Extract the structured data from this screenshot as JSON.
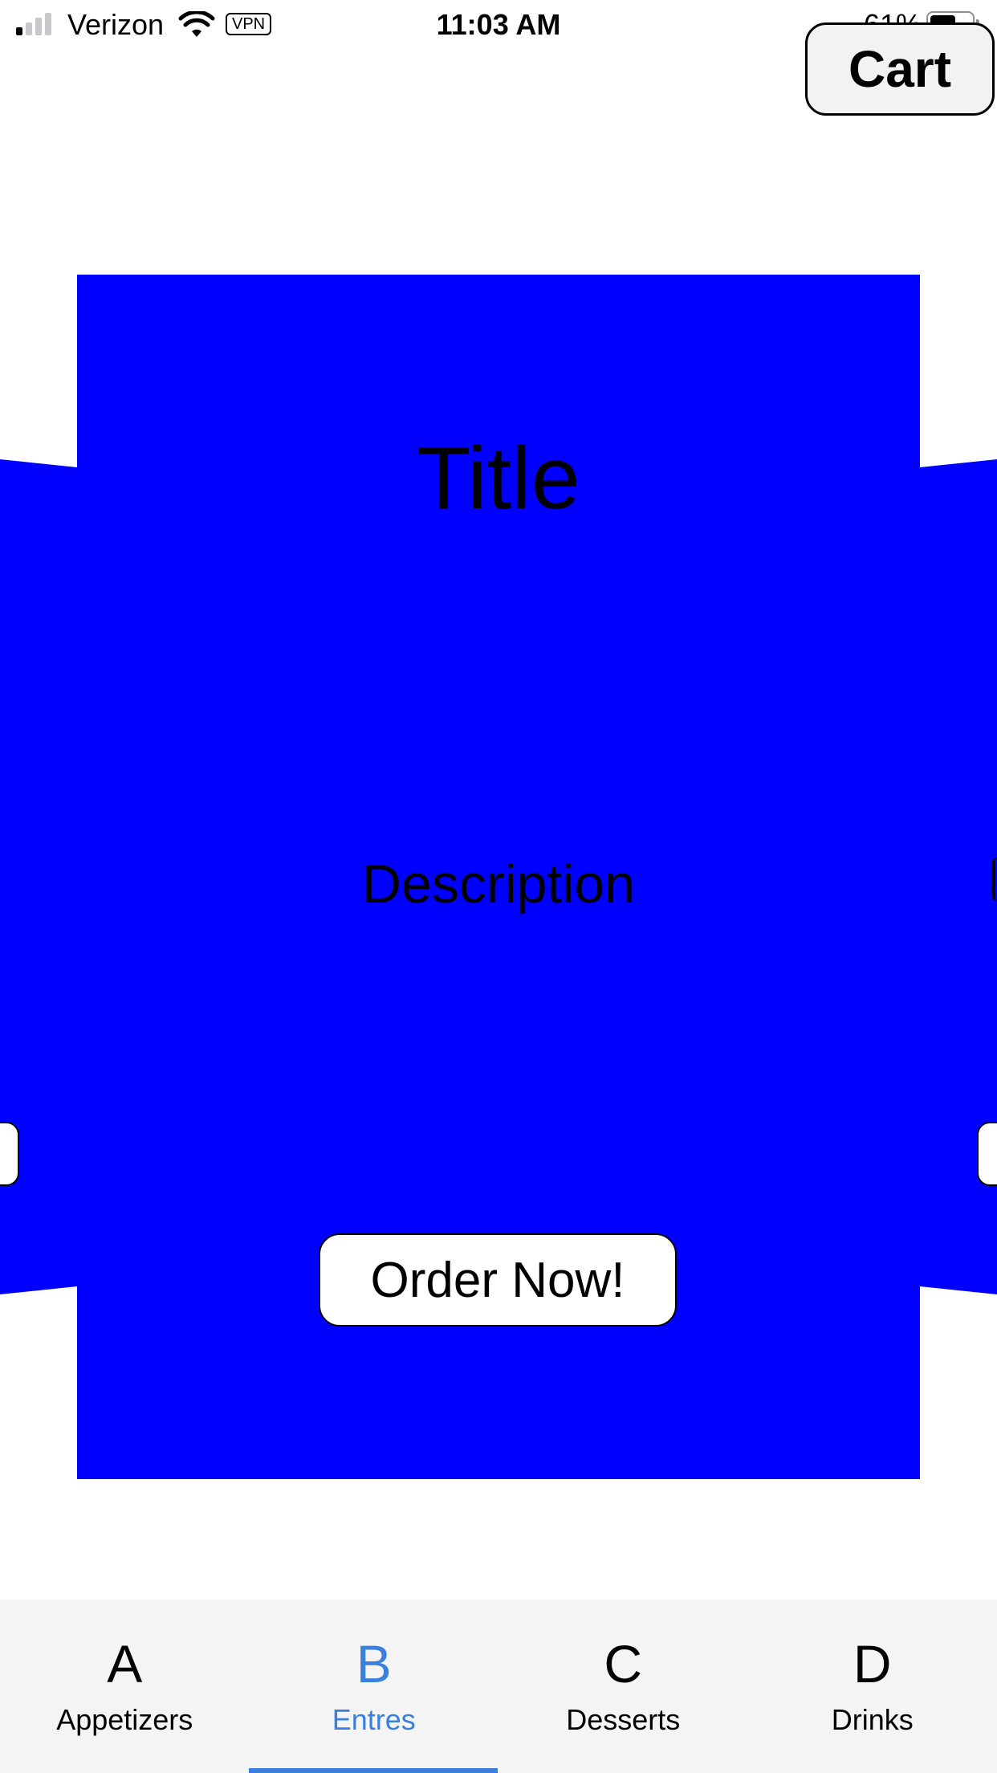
{
  "status_bar": {
    "carrier": "Verizon",
    "vpn_label": "VPN",
    "time": "11:03 AM",
    "battery_percent": "61%",
    "battery_level": 0.61,
    "signal_bars_active": 1,
    "signal_bars_total": 4
  },
  "header": {
    "cart_label": "Cart"
  },
  "card": {
    "title": "Title",
    "description": "Description",
    "order_label": "Order Now!",
    "color": "#0000ff"
  },
  "tabs": [
    {
      "letter": "A",
      "label": "Appetizers",
      "active": false
    },
    {
      "letter": "B",
      "label": "Entres",
      "active": true
    },
    {
      "letter": "C",
      "label": "Desserts",
      "active": false
    },
    {
      "letter": "D",
      "label": "Drinks",
      "active": false
    }
  ],
  "colors": {
    "accent": "#3a7fdc",
    "tab_bar_bg": "#f4f4f4"
  }
}
